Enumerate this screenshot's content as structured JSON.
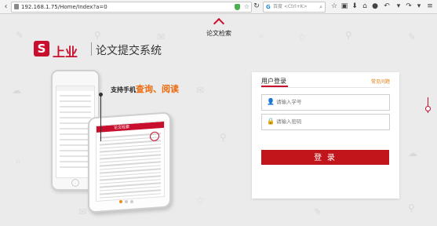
{
  "browser": {
    "url": "192.168.1.75/Home/Index?a=0",
    "search_placeholder": "百度 <Ctrl+K>",
    "search_engine_glyph": "G",
    "icons": [
      "back-icon",
      "lock-icon",
      "shield-icon",
      "bookmark-star-icon",
      "search-icon",
      "star-icon",
      "clipboard-icon",
      "download-icon",
      "home-icon",
      "chat-icon",
      "undo-icon",
      "redo-icon",
      "menu-icon"
    ]
  },
  "page": {
    "top_link_label": "论文检索",
    "logo": {
      "mark": "S",
      "company": "上业",
      "system_name": "论文提交系统"
    },
    "promo": {
      "prefix": "支持手机",
      "highlight": "查询、阅读"
    },
    "phone_header": "论文检索",
    "carousel": {
      "count": 3,
      "active": 0
    },
    "colors": {
      "brand": "#c8102e",
      "accent": "#ee6a0c",
      "button": "#c0151b"
    }
  },
  "login": {
    "title": "用户登录",
    "help_link": "常见问题",
    "username_placeholder": "请输入学号",
    "password_placeholder": "请输入密码",
    "submit_label": "登 录"
  }
}
